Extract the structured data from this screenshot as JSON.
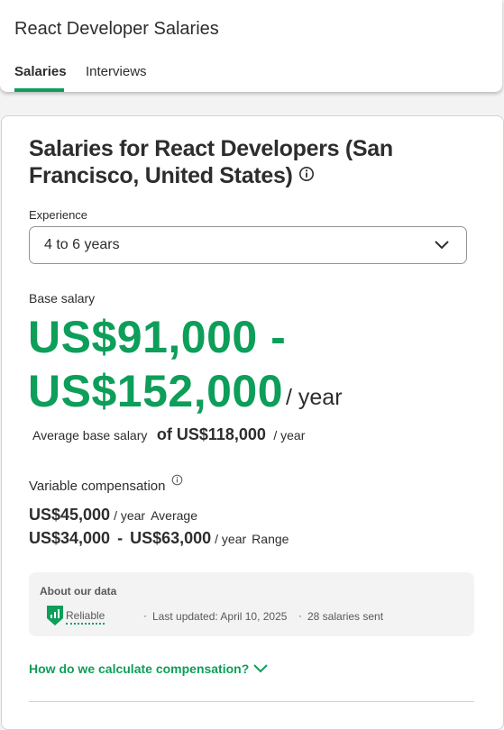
{
  "header": {
    "title": "React Developer Salaries",
    "tabs": [
      {
        "label": "Salaries",
        "active": true
      },
      {
        "label": "Interviews",
        "active": false
      }
    ]
  },
  "main": {
    "title": "Salaries for React Developers (San Francisco, United States)",
    "experience": {
      "label": "Experience",
      "value": "4 to 6 years"
    },
    "base_salary": {
      "label": "Base salary",
      "range_low": "US$91,000 -",
      "range_high": "US$152,000",
      "per_year": "/ year",
      "average_label": "Average base salary",
      "average_value": "of US$118,000",
      "average_per": "/ year"
    },
    "variable": {
      "label": "Variable compensation",
      "average_amount": "US$45,000",
      "average_per": "/ year",
      "average_tag": "Average",
      "range_low": "US$34,000",
      "range_dash": "-",
      "range_high": "US$63,000",
      "range_per": "/ year",
      "range_tag": "Range"
    },
    "about": {
      "title": "About our data",
      "reliability": "Reliable",
      "separator": "·",
      "last_updated": "Last updated: April 10, 2025",
      "salaries_sent": "28 salaries sent"
    },
    "how_link": "How do we calculate compensation?"
  },
  "colors": {
    "accent": "#0d9e5a",
    "text": "#2d2d2d",
    "muted": "#595959",
    "background": "#f3f3f3"
  },
  "icons": [
    "info-icon",
    "chevron-down-icon",
    "shield-bars-icon"
  ]
}
